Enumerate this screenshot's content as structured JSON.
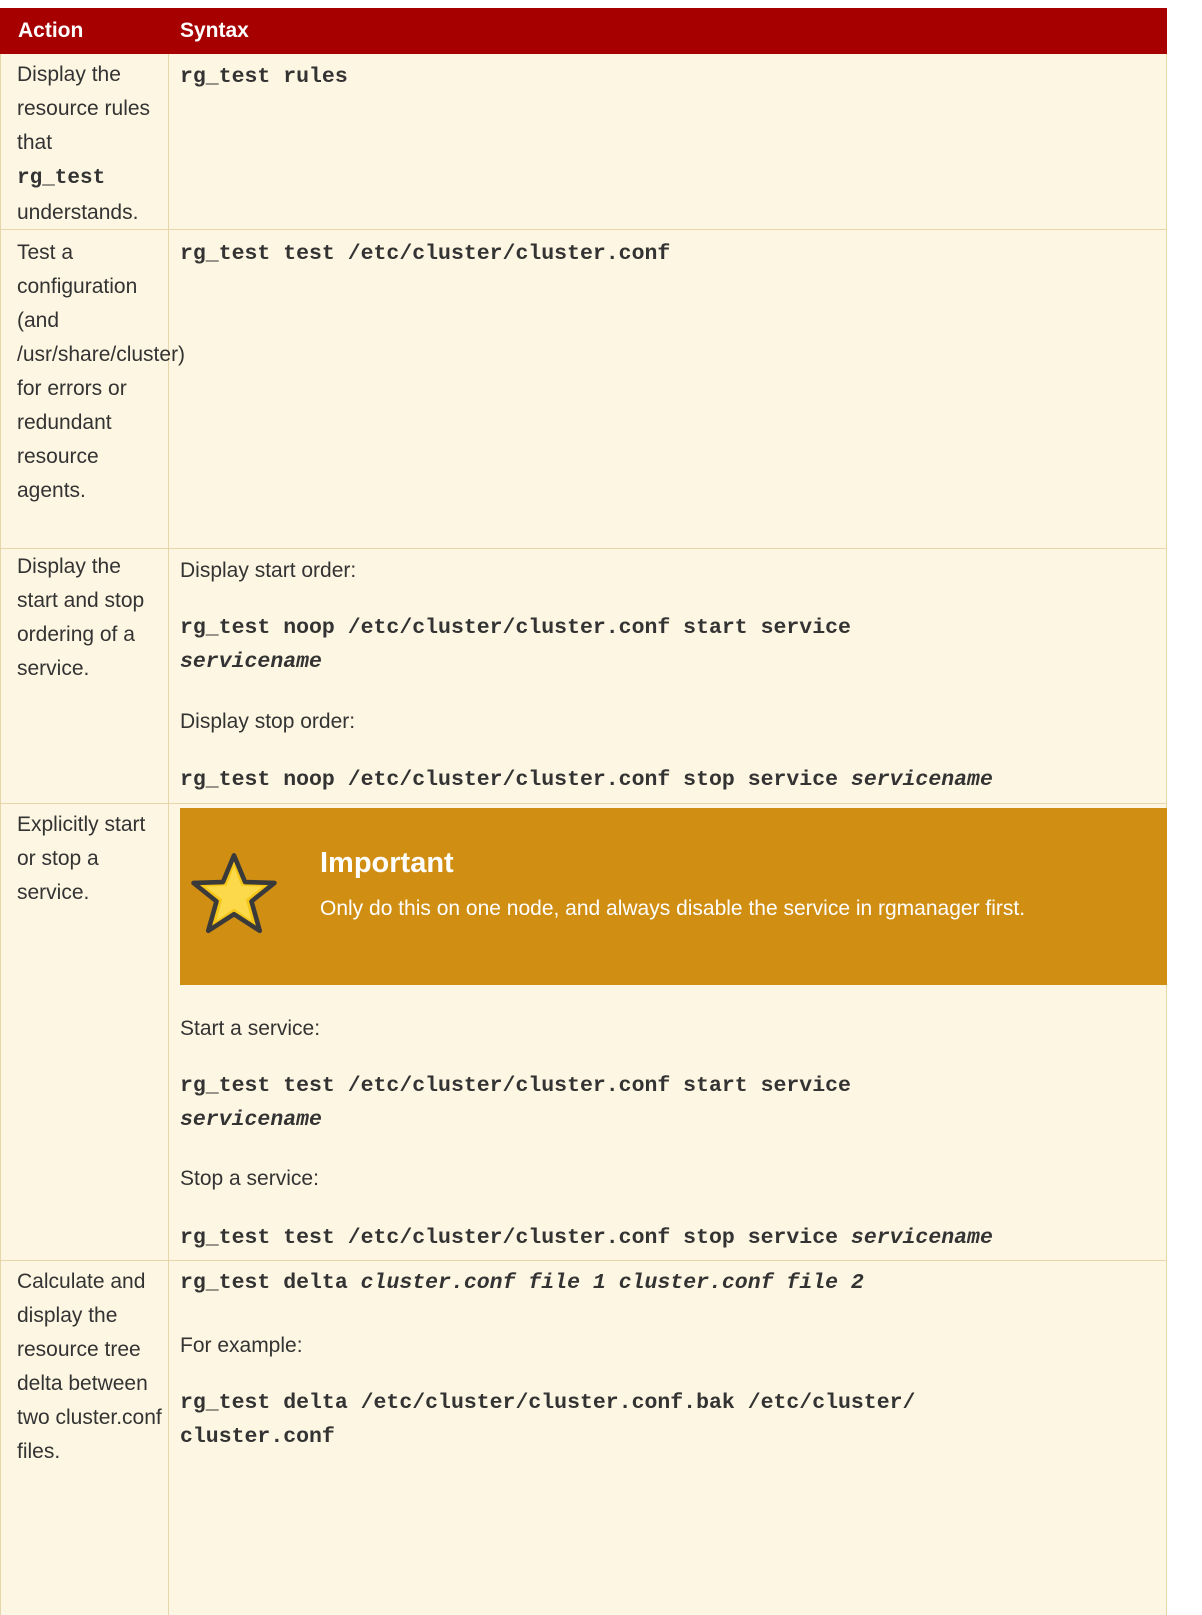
{
  "header": {
    "action": "Action",
    "syntax": "Syntax"
  },
  "rows": [
    {
      "action_pre": "Display the resource rules that",
      "action_code": "rg_test",
      "action_post": "understands.",
      "cmd": "rg_test rules"
    },
    {
      "action": "Test a configuration (and /usr/share/cluster) for errors or redundant resource agents.",
      "cmd": "rg_test test /etc/cluster/cluster.conf"
    },
    {
      "action": "Display the start and stop ordering of a service.",
      "label1": "Display start order:",
      "cmd1a": "rg_test noop /etc/cluster/cluster.conf start service",
      "cmd1b": "servicename",
      "label2": "Display stop order:",
      "cmd2a": "rg_test noop /etc/cluster/cluster.conf stop service",
      "cmd2b": "servicename"
    },
    {
      "action": "Explicitly start or stop a service.",
      "important_title": "Important",
      "important_body": "Only do this on one node, and always disable the service in rgmanager first.",
      "label1": "Start a service:",
      "cmd1a": "rg_test test /etc/cluster/cluster.conf start service",
      "cmd1b": "servicename",
      "label2": "Stop a service:",
      "cmd2a": "rg_test test /etc/cluster/cluster.conf stop service",
      "cmd2b": "servicename"
    },
    {
      "action": "Calculate and display the resource tree delta between two cluster.conf files.",
      "cmd1a": "rg_test delta",
      "cmd1b": "cluster.conf file 1",
      "cmd1c": "cluster.conf file 2",
      "label1": "For example:",
      "cmd2a": "rg_test delta /etc/cluster/cluster.conf.bak /etc/cluster/",
      "cmd2b": "cluster.conf"
    }
  ],
  "colors": {
    "header_bg": "#a70000",
    "row_bg": "#fdf6e2",
    "important_bg": "#d08e13",
    "star_fill": "#f5c518"
  },
  "icons": {
    "important": "star-icon"
  }
}
